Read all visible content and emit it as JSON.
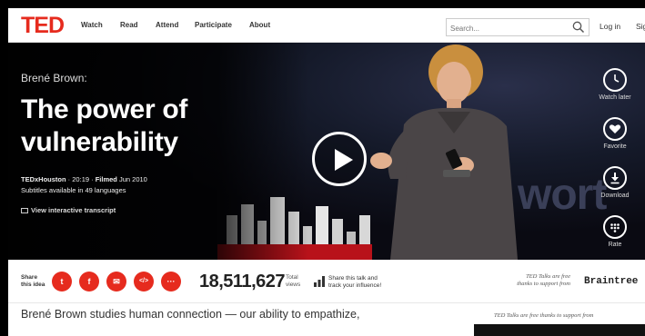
{
  "brand": {
    "logo": "TED",
    "accent": "#e62b1e"
  },
  "nav": {
    "links": [
      "Watch",
      "Read",
      "Attend",
      "Participate",
      "About"
    ],
    "search_placeholder": "Search...",
    "login": "Log in",
    "signup": "Sig"
  },
  "hero": {
    "speaker": "Brené Brown:",
    "title": "The power of vulnerability",
    "event": "TEDxHouston",
    "duration": "20:19",
    "filmed_label": "Filmed",
    "filmed_date": "Jun 2010",
    "subtitles": "Subtitles available in 49 languages",
    "transcript_link": "View interactive transcript",
    "stage_text": "wort",
    "actions": [
      {
        "label": "Watch later",
        "icon": "clock-icon"
      },
      {
        "label": "Favorite",
        "icon": "heart-icon"
      },
      {
        "label": "Download",
        "icon": "download-icon"
      },
      {
        "label": "Rate",
        "icon": "dots-grid-icon"
      }
    ]
  },
  "share": {
    "label_line1": "Share",
    "label_line2": "this idea",
    "buttons": [
      {
        "name": "twitter",
        "glyph": "t"
      },
      {
        "name": "facebook",
        "glyph": "f"
      },
      {
        "name": "email",
        "glyph": "✉"
      },
      {
        "name": "embed",
        "glyph": "</>"
      },
      {
        "name": "more",
        "glyph": "···"
      }
    ],
    "views": "18,511,627",
    "views_label_1": "Total",
    "views_label_2": "views",
    "track_line1": "Share this talk and",
    "track_line2": "track your influence!",
    "sponsor_line1": "TED Talks are free",
    "sponsor_line2": "thanks to support from",
    "sponsor_name": "Braintree"
  },
  "description": "Brené Brown studies human connection — our ability to empathize,",
  "sponsor_box_text": "TED Talks are free thanks to support from"
}
